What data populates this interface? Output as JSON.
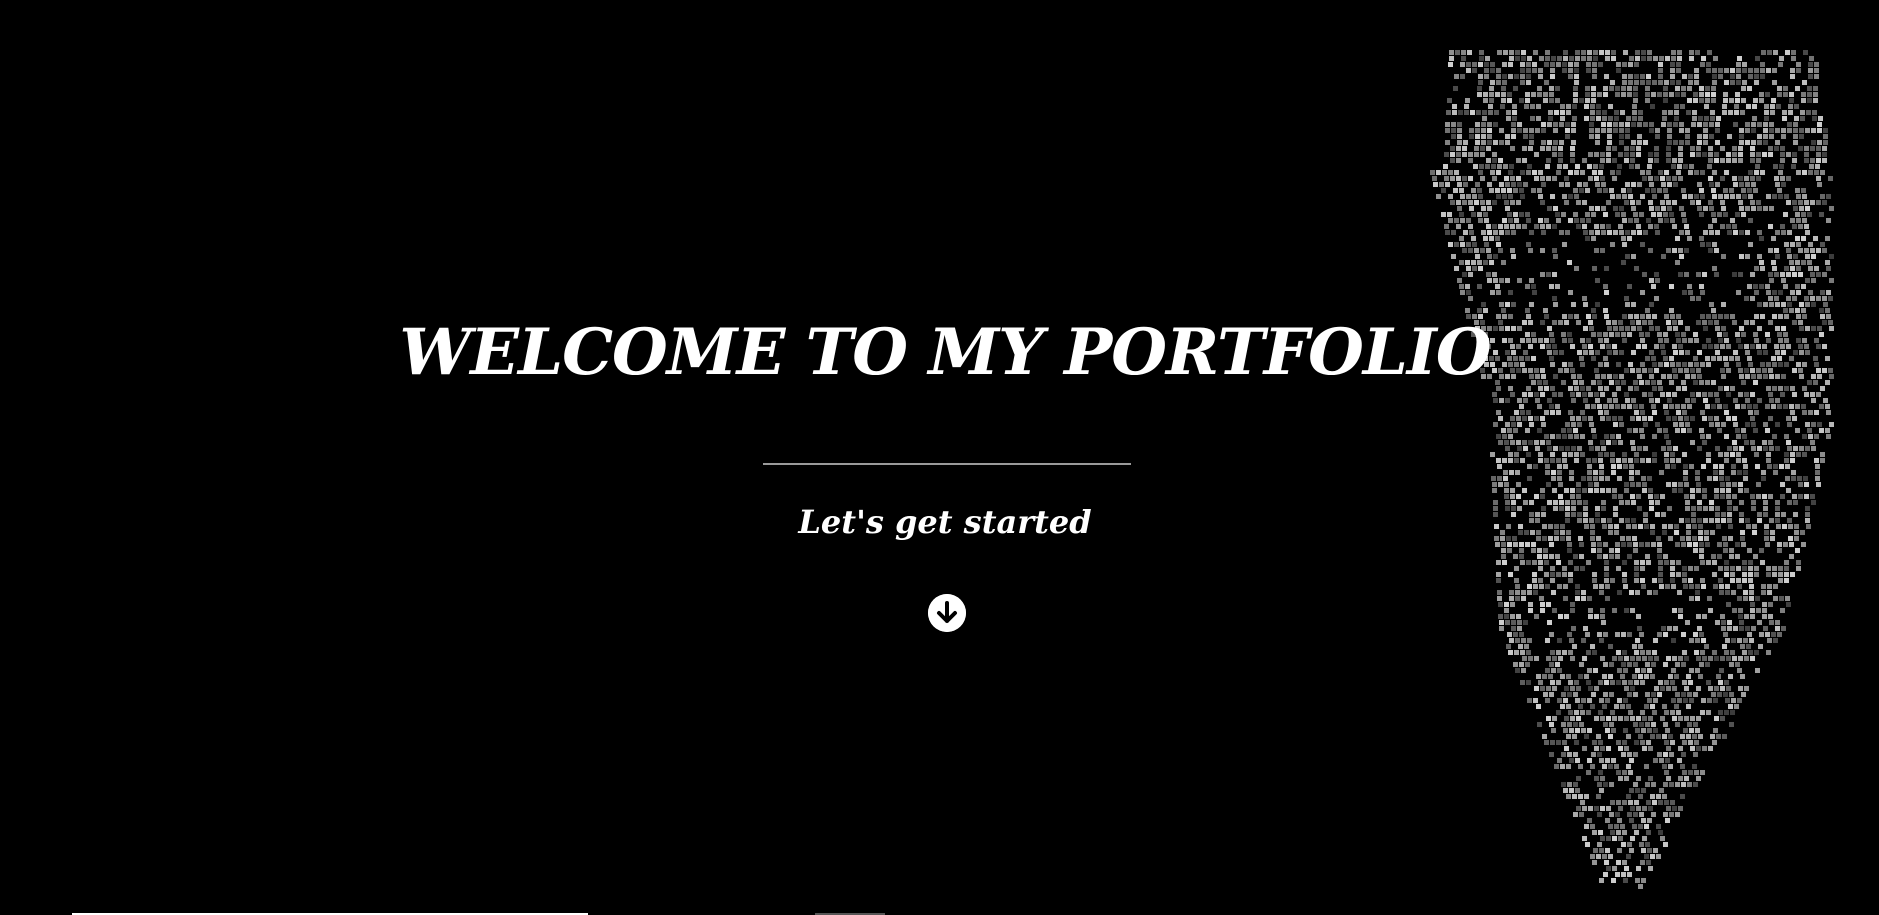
{
  "hero": {
    "title": "WELCOME TO MY PORTFOLIO",
    "subtitle": "Let's get started",
    "scroll_icon": "arrow-down-circle-icon",
    "background_art": "pixelated-mask-art"
  },
  "colors": {
    "background": "#000000",
    "text": "#ffffff",
    "divider": "#9a9a9a"
  }
}
